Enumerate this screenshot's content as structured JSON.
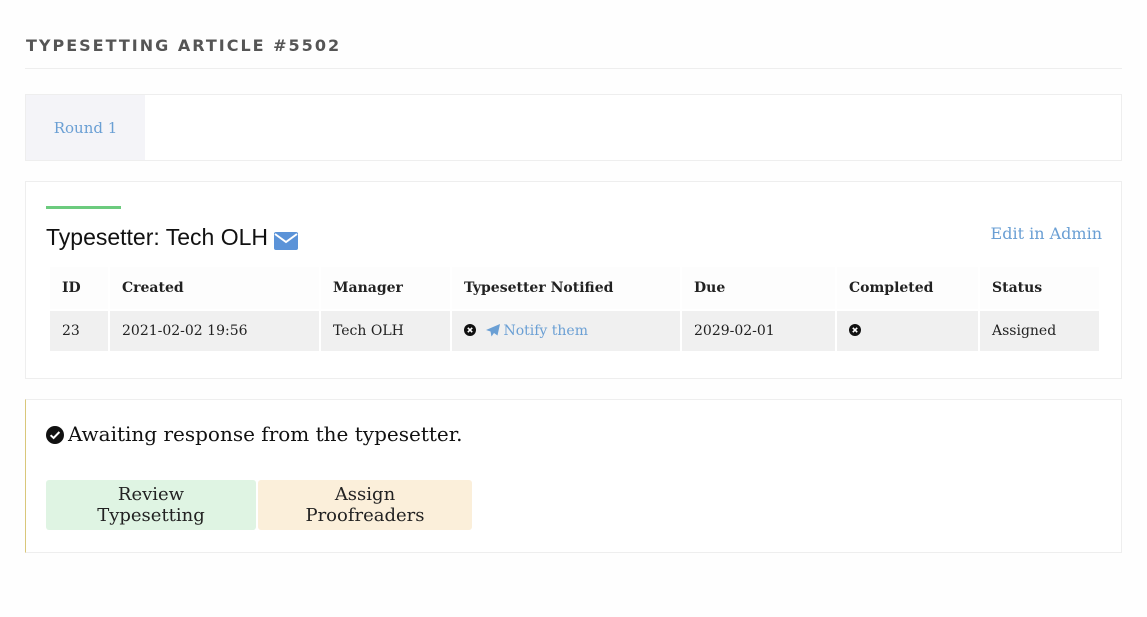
{
  "page": {
    "title": "TYPESETTING ARTICLE #5502"
  },
  "tabs": [
    {
      "label": "Round 1"
    }
  ],
  "assignment": {
    "heading": "Typesetter: Tech OLH",
    "edit_link": "Edit in Admin",
    "columns": [
      "ID",
      "Created",
      "Manager",
      "Typesetter Notified",
      "Due",
      "Completed",
      "Status"
    ],
    "row": {
      "id": "23",
      "created": "2021-02-02 19:56",
      "manager": "Tech OLH",
      "notified_action": "Notify them",
      "due": "2029-02-01",
      "status": "Assigned"
    },
    "icons": {
      "heading": "envelope-icon",
      "not_notified": "times-circle-icon",
      "notify": "paper-plane-icon",
      "not_completed": "times-circle-icon"
    }
  },
  "status_panel": {
    "message": "Awaiting response from the typesetter.",
    "icon": "check-circle-icon",
    "buttons": {
      "review": "Review Typesetting",
      "proofreaders": "Assign Proofreaders"
    }
  },
  "colors": {
    "link": "#6a9fd4",
    "accent": "#6ccb7e",
    "review_bg": "#dff4e3",
    "proof_bg": "#fbefda"
  }
}
